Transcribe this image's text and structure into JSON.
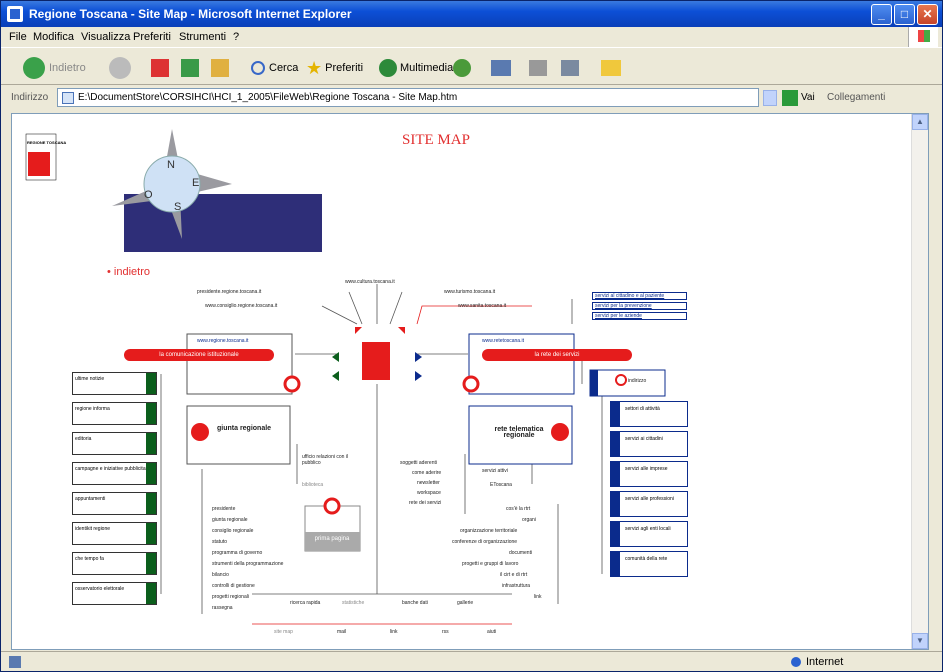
{
  "window": {
    "title": "Regione Toscana - Site Map - Microsoft Internet Explorer"
  },
  "menu": [
    "File",
    "Modifica",
    "Visualizza",
    "Preferiti",
    "Strumenti",
    "?"
  ],
  "toolbar": {
    "back": "Indietro",
    "search": "Cerca",
    "favorites": "Preferiti",
    "multimedia": "Multimedia"
  },
  "address": {
    "label": "Indirizzo",
    "value": "E:\\DocumentStore\\CORSIHCI\\HCI_1_2005\\FileWeb\\Regione Toscana - Site Map.htm",
    "go": "Vai",
    "links": "Collegamenti"
  },
  "status": {
    "zone": "Internet"
  },
  "page": {
    "title": "SITE MAP",
    "back_link": "indietro",
    "logo_text": "REGIONE TOSCANA",
    "compass_letters": [
      "N",
      "E",
      "S",
      "O"
    ],
    "top_links": [
      "presidente.regione.toscana.it",
      "www.consiglio.regione.toscana.it",
      "www.cultura.toscana.it",
      "www.turismo.toscana.it",
      "www.sanita.toscana.it"
    ],
    "sanita_links": [
      "servizi al cittadino e al paziente",
      "servizi per la prevenzione",
      "servizi per le aziende"
    ],
    "left_box_url": "www.regione.toscana.it",
    "left_pill": "la comunicazione istituzionale",
    "right_box_url": "www.retetoscana.it",
    "right_pill": "la rete dei servizi",
    "left_items": [
      "ultime notizie",
      "regione informa",
      "editoria",
      "campagne e iniziative pubblicitarie",
      "appuntamenti",
      "identikit regione",
      "che tempo fa",
      "osservatorio elettorale"
    ],
    "giunta_title": "giunta regionale",
    "giunta_side": [
      "ufficio relazioni con il pubblico",
      "biblioteca"
    ],
    "giunta_items": [
      "presidente",
      "giunta regionale",
      "consiglio regionale",
      "statuto",
      "programma di governo",
      "strumenti della programmazione",
      "bilancio",
      "controlli di gestione",
      "progetti regionali",
      "rassegna"
    ],
    "prima_pagina": "prima pagina",
    "bottom_top": [
      "ricerca rapida",
      "statistiche",
      "banche dati",
      "gallerie"
    ],
    "bottom_row": [
      "site map",
      "mail",
      "link",
      "rss",
      "aiuti"
    ],
    "indirizzo_label": "indirizzo",
    "right_items": [
      "settori di attività",
      "servizi ai cittadini",
      "servizi alle imprese",
      "servizi alle professioni",
      "servizi agli enti locali",
      "comunità della rete"
    ],
    "rete_title": "rete telematica regionale",
    "rete_left": [
      "soggetti aderenti",
      "come aderire",
      "newsletter",
      "workspace",
      "rete dei servizi"
    ],
    "rete_mid": [
      "servizi attivi",
      "EToscana"
    ],
    "rete_items": [
      "cos'è la rtrt",
      "organi",
      "organizzazione territoriale",
      "conferenze di organizzazione",
      "documenti",
      "progetti e gruppi di lavoro",
      "il cirt e di rtrt",
      "infrastruttura",
      "link"
    ]
  },
  "colors": {
    "red": "#e51c1c",
    "green": "#0b5e1c",
    "navy": "#0b2b8c",
    "banner": "#2e2e78"
  }
}
